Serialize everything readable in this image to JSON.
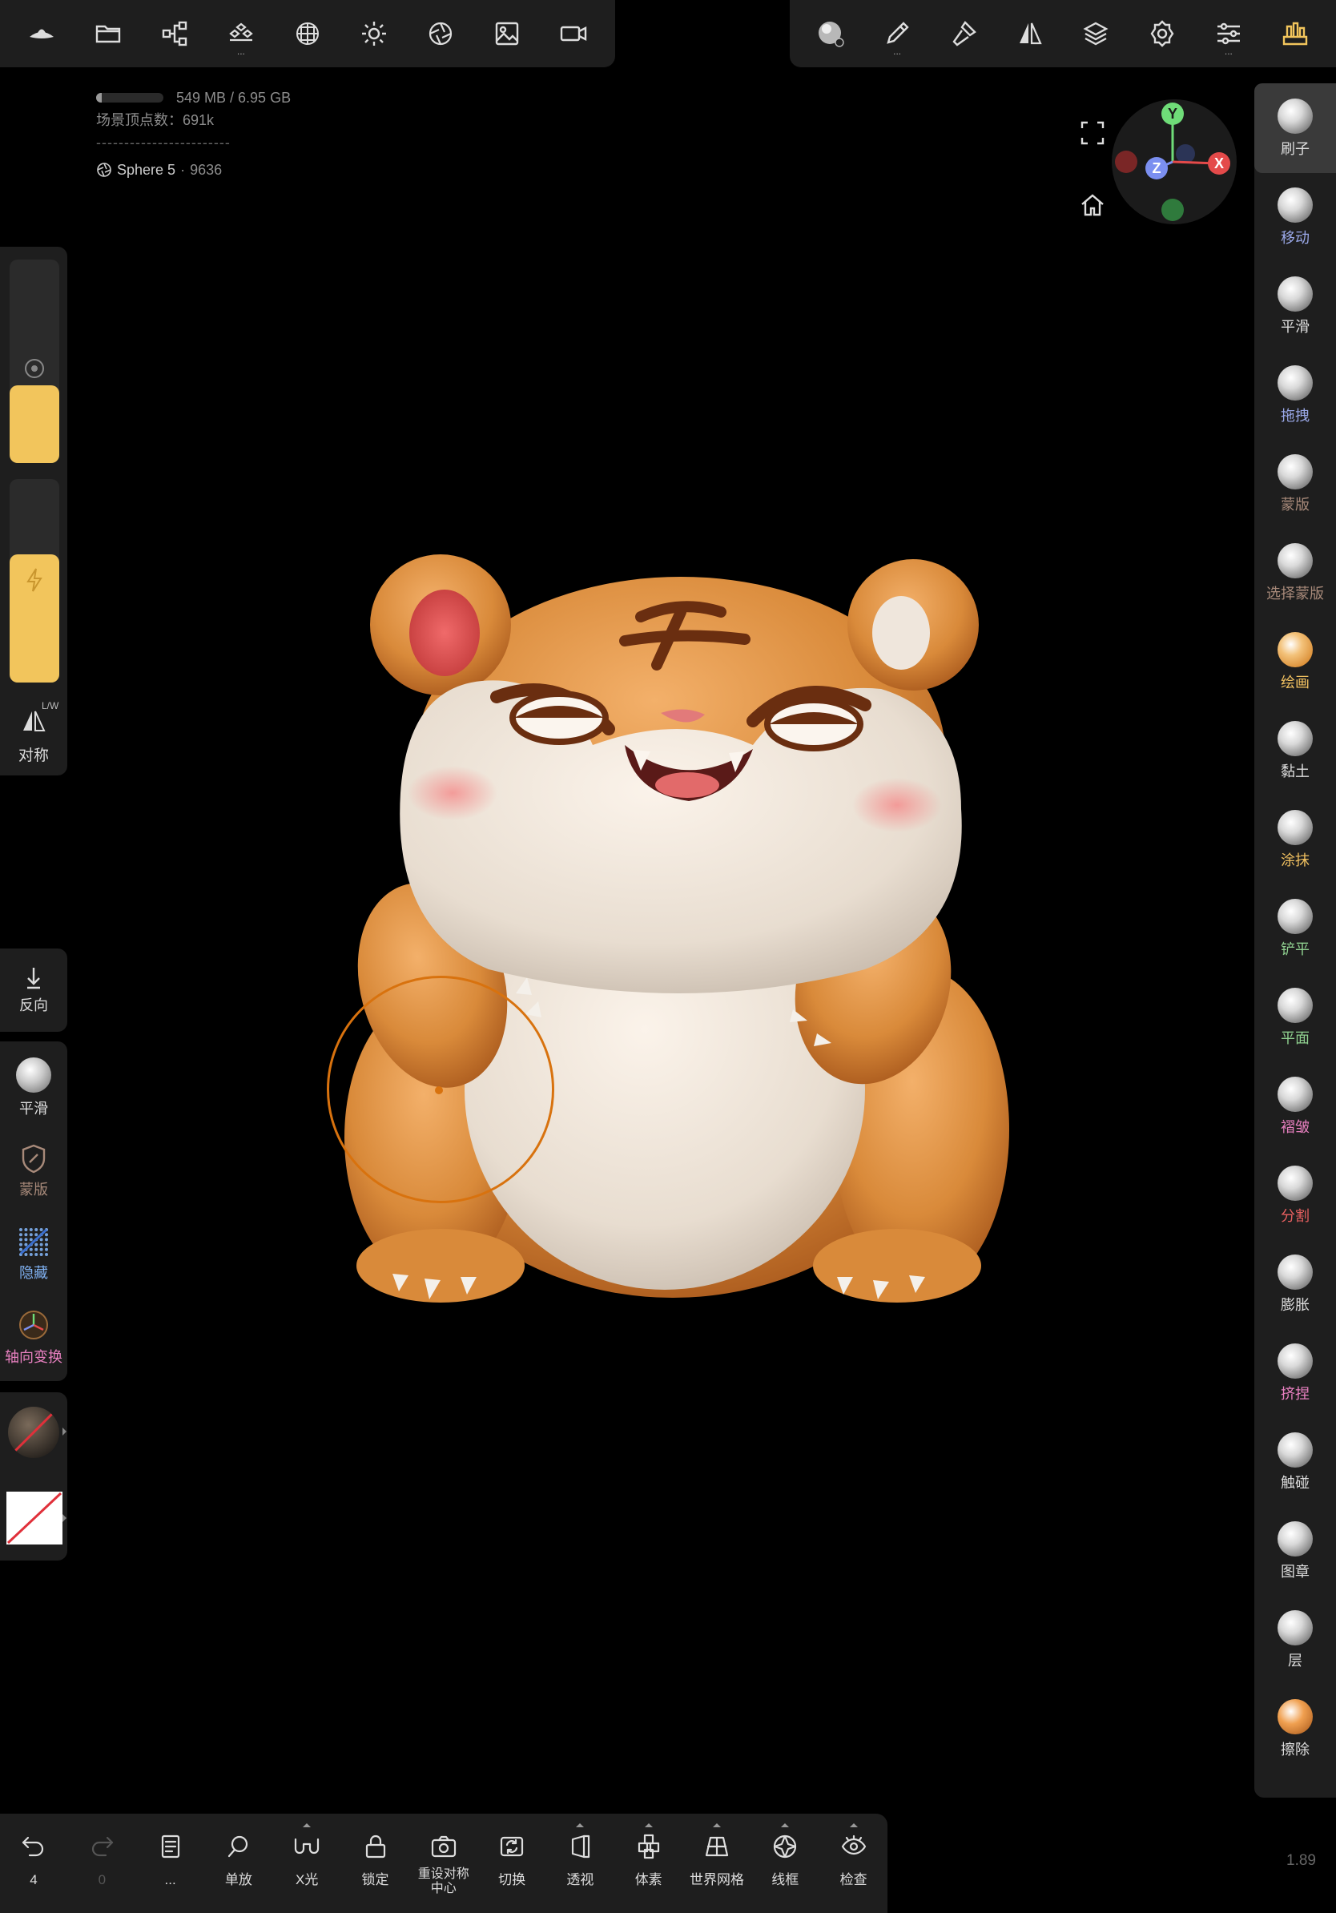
{
  "top_left_tools": [
    {
      "icon": "app-logo-icon"
    },
    {
      "icon": "folder-icon"
    },
    {
      "icon": "share-nodes-icon"
    },
    {
      "icon": "scene-stack-icon",
      "more": "..."
    },
    {
      "icon": "topology-icon"
    },
    {
      "icon": "light-sun-icon"
    },
    {
      "icon": "camera-aperture-icon"
    },
    {
      "icon": "image-icon"
    },
    {
      "icon": "video-camera-icon"
    }
  ],
  "top_right_tools": [
    {
      "icon": "material-sphere-icon"
    },
    {
      "icon": "brush-pen-icon",
      "more": "..."
    },
    {
      "icon": "paint-brush-icon"
    },
    {
      "icon": "symmetry-icon"
    },
    {
      "icon": "layers-icon"
    },
    {
      "icon": "settings-gear-icon"
    },
    {
      "icon": "sliders-icon",
      "more": "..."
    },
    {
      "icon": "tool-case-icon"
    }
  ],
  "info": {
    "memory": "549 MB / 6.95 GB",
    "memory_used_fraction": 0.08,
    "vertices": "场景顶点数：691k",
    "separator": "------------------------",
    "object_name": "Sphere 5",
    "object_separator": " · ",
    "object_count": "9636"
  },
  "gizmo": {
    "y": "Y",
    "x": "X",
    "z": "Z"
  },
  "right_brushes": [
    {
      "label": "刷子",
      "color": "#dddddd",
      "active": true
    },
    {
      "label": "移动",
      "color": "#9aa8e8"
    },
    {
      "label": "平滑",
      "color": "#dddddd"
    },
    {
      "label": "拖拽",
      "color": "#9aa8e8"
    },
    {
      "label": "蒙版",
      "color": "#a88a7a"
    },
    {
      "label": "选择蒙版",
      "color": "#a88a7a"
    },
    {
      "label": "绘画",
      "color": "#f0c060"
    },
    {
      "label": "黏土",
      "color": "#dddddd"
    },
    {
      "label": "涂抹",
      "color": "#f0c060"
    },
    {
      "label": "铲平",
      "color": "#8fd08f"
    },
    {
      "label": "平面",
      "color": "#8fd08f"
    },
    {
      "label": "褶皱",
      "color": "#e880c0"
    },
    {
      "label": "分割",
      "color": "#e86060"
    },
    {
      "label": "膨胀",
      "color": "#dddddd"
    },
    {
      "label": "挤捏",
      "color": "#e880c0"
    },
    {
      "label": "触碰",
      "color": "#dddddd"
    },
    {
      "label": "图章",
      "color": "#dddddd"
    },
    {
      "label": "层",
      "color": "#dddddd"
    },
    {
      "label": "擦除",
      "color": "#dddddd"
    }
  ],
  "left_sliders": {
    "radius_fill": 0.38,
    "intensity_fill": 0.63
  },
  "symmetry": {
    "label": "对称",
    "shortcut": "L/W"
  },
  "reverse": {
    "label": "反向"
  },
  "left_tools": [
    {
      "label": "平滑",
      "color": "#dddddd"
    },
    {
      "label": "蒙版",
      "color": "#a88a7a"
    },
    {
      "label": "隐藏",
      "color": "#7fb0f0"
    },
    {
      "label": "轴向变换",
      "color": "#e880c0"
    }
  ],
  "bottom_tools": [
    {
      "label": "4",
      "icon": "undo-icon"
    },
    {
      "label": "0",
      "icon": "redo-icon",
      "disabled": true
    },
    {
      "label": "...",
      "icon": "notes-icon"
    },
    {
      "label": "单放",
      "icon": "search-icon"
    },
    {
      "label": "X光",
      "icon": "xray-glasses-icon",
      "caret": true
    },
    {
      "label": "锁定",
      "icon": "lock-icon"
    },
    {
      "label": "重设对称\n中心",
      "icon": "camera-reset-icon"
    },
    {
      "label": "切换",
      "icon": "switch-icon"
    },
    {
      "label": "透视",
      "icon": "perspective-icon",
      "caret": true
    },
    {
      "label": "体素",
      "icon": "voxel-icon",
      "caret": true
    },
    {
      "label": "世界网格",
      "icon": "world-grid-icon",
      "caret": true
    },
    {
      "label": "线框",
      "icon": "wireframe-icon",
      "caret": true
    },
    {
      "label": "检查",
      "icon": "inspect-eye-icon",
      "caret": true
    }
  ],
  "version": "1.89",
  "colors": {
    "accent": "#f2c55c",
    "brush_cursor": "#d8720e",
    "panel": "#1e1e1e"
  }
}
